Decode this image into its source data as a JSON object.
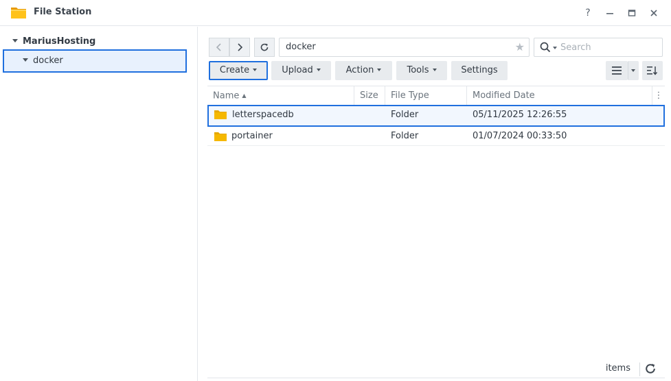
{
  "window": {
    "title": "File Station",
    "help_label": "?",
    "minimize_label": "—",
    "maximize_label": "□",
    "close_label": "✕"
  },
  "sidebar": {
    "root_label": "MariusHosting",
    "items": [
      {
        "label": "docker",
        "selected": true
      }
    ]
  },
  "toolbar": {
    "path": "docker",
    "search_placeholder": "Search",
    "buttons": {
      "create": "Create",
      "upload": "Upload",
      "action": "Action",
      "tools": "Tools",
      "settings": "Settings"
    }
  },
  "table": {
    "columns": {
      "name": "Name",
      "size": "Size",
      "file_type": "File Type",
      "modified_date": "Modified Date"
    },
    "rows": [
      {
        "name": "letterspacedb",
        "size": "",
        "file_type": "Folder",
        "modified": "05/11/2025 12:26:55",
        "selected": true
      },
      {
        "name": "portainer",
        "size": "",
        "file_type": "Folder",
        "modified": "01/07/2024 00:33:50",
        "selected": false
      }
    ]
  },
  "footer": {
    "items_label": "items"
  },
  "colors": {
    "selection_border": "#1f6fde",
    "folder": "#f5b800",
    "button_bg": "#e8ebee"
  }
}
